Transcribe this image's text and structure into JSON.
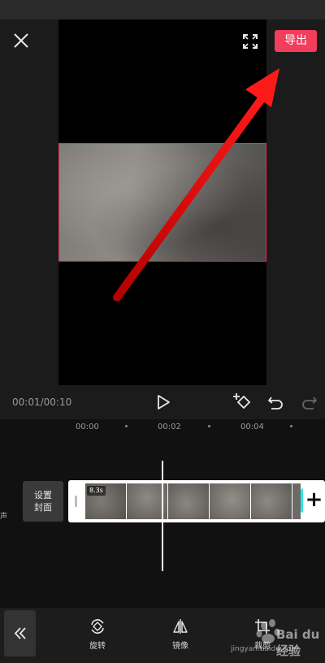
{
  "header": {
    "export_label": "导出"
  },
  "playback": {
    "time": "00:01/00:10"
  },
  "timeline": {
    "ruler": [
      "00:00",
      "00:02",
      "00:04"
    ],
    "audio_label": "声",
    "cover_line1": "设置",
    "cover_line2": "封面",
    "clip_duration": "8.3s"
  },
  "toolbar": {
    "items": [
      {
        "label": "旋转",
        "icon": "rotate-icon"
      },
      {
        "label": "镜像",
        "icon": "mirror-icon"
      },
      {
        "label": "裁剪",
        "icon": "crop-icon"
      }
    ]
  },
  "watermark": {
    "brand": "Bai du 经验",
    "url": "jingyan.baidu.com"
  },
  "colors": {
    "accent": "#f23d5b",
    "annotation_arrow": "#e01010",
    "add_clip_edge": "#2ee6e6"
  }
}
